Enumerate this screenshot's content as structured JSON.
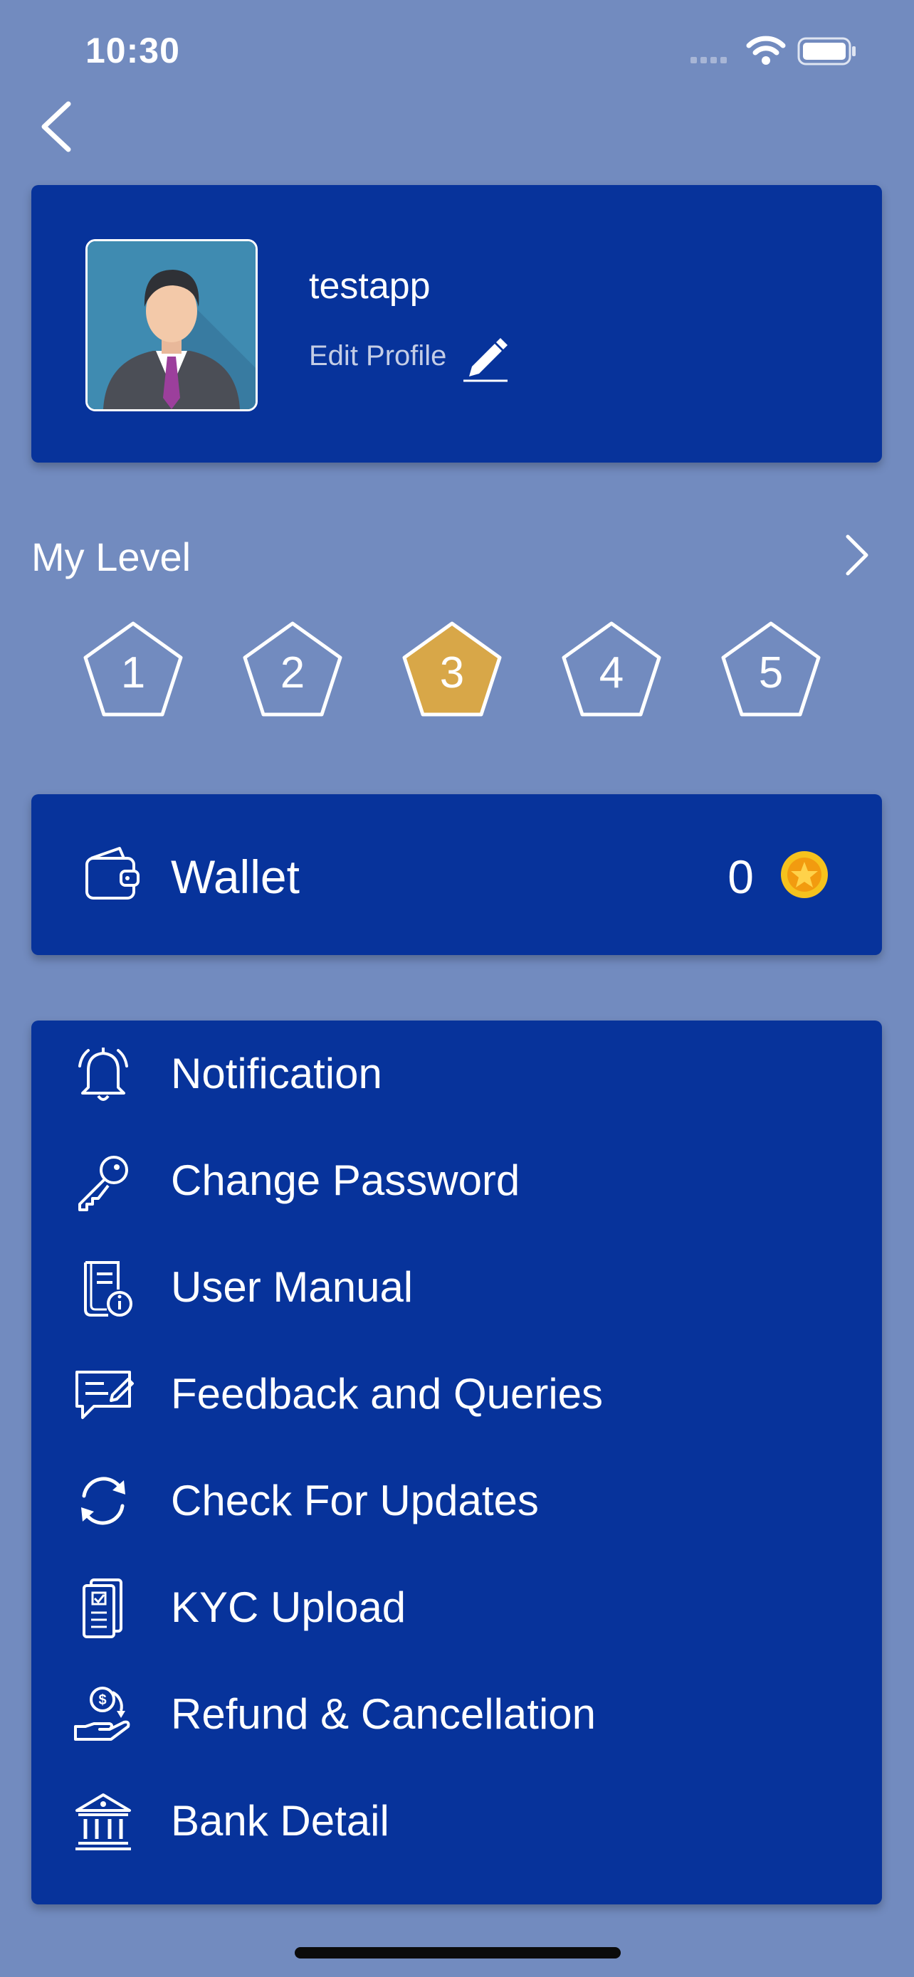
{
  "status_bar": {
    "time": "10:30"
  },
  "profile": {
    "username": "testapp",
    "edit_label": "Edit Profile"
  },
  "level": {
    "title": "My Level",
    "levels": [
      "1",
      "2",
      "3",
      "4",
      "5"
    ],
    "current_level": "3",
    "active_color": "#d8a748"
  },
  "wallet": {
    "label": "Wallet",
    "amount": "0"
  },
  "menu": [
    {
      "label": "Notification",
      "icon": "bell-icon"
    },
    {
      "label": "Change Password",
      "icon": "key-icon"
    },
    {
      "label": "User Manual",
      "icon": "manual-book-icon"
    },
    {
      "label": "Feedback and Queries",
      "icon": "feedback-icon"
    },
    {
      "label": "Check For Updates",
      "icon": "refresh-icon"
    },
    {
      "label": "KYC Upload",
      "icon": "document-check-icon"
    },
    {
      "label": "Refund & Cancellation",
      "icon": "refund-icon"
    },
    {
      "label": "Bank Detail",
      "icon": "bank-icon"
    }
  ],
  "colors": {
    "background": "#728bbf",
    "card": "#07339b",
    "coin": "#f6c21d"
  }
}
